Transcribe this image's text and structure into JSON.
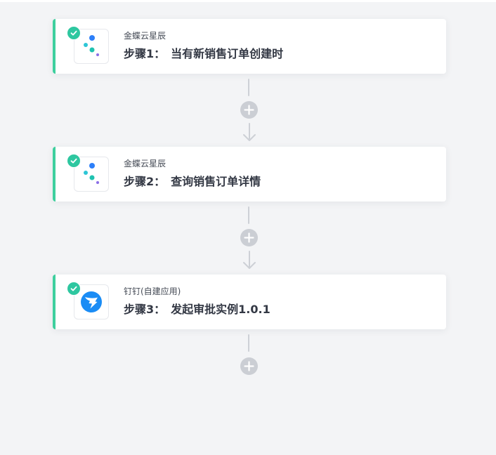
{
  "steps": [
    {
      "app_name": "金蝶云星辰",
      "step_label": "步骤1：",
      "title": "当有新销售订单创建时",
      "icon": "kingdee-dots-icon",
      "status": "completed"
    },
    {
      "app_name": "金蝶云星辰",
      "step_label": "步骤2：",
      "title": "查询销售订单详情",
      "icon": "kingdee-dots-icon",
      "status": "completed"
    },
    {
      "app_name": "钉钉(自建应用)",
      "step_label": "步骤3：",
      "title": "发起审批实例1.0.1",
      "icon": "dingtalk-icon",
      "status": "completed"
    }
  ],
  "colors": {
    "accent": "#3ecf9e",
    "check": "#2ec7a0",
    "connector": "#cdd0d6",
    "background": "#f3f4f6",
    "dingtalk_blue": "#1a8cf5"
  }
}
